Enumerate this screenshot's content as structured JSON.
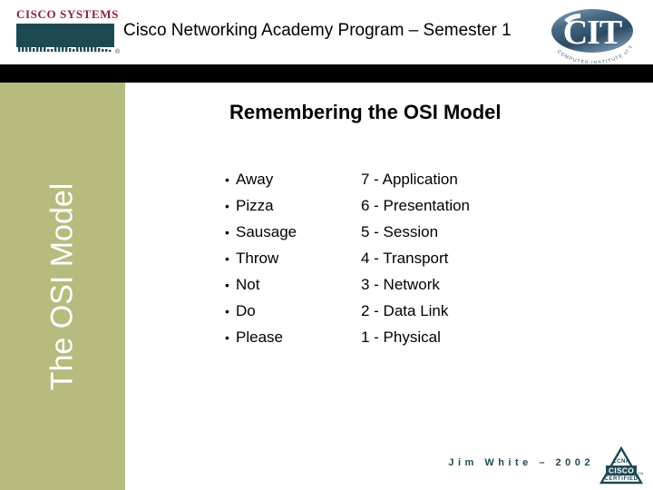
{
  "header": {
    "title": "Cisco Networking Academy Program – Semester 1",
    "cisco_logo": {
      "wordmark": "CISCO SYSTEMS",
      "registered_mark": "®"
    },
    "cit_logo": {
      "letters": "CIT",
      "arc_text": "COMPUTER INSTITUTE of TECHNOLOGY"
    }
  },
  "sidebar": {
    "label": "The OSI Model",
    "color": "#b7bc7e"
  },
  "main": {
    "heading": "Remembering the OSI Model",
    "mnemonic": [
      {
        "bullet": "•",
        "word": "Away"
      },
      {
        "bullet": "•",
        "word": "Pizza"
      },
      {
        "bullet": "•",
        "word": "Sausage"
      },
      {
        "bullet": "•",
        "word": "Throw"
      },
      {
        "bullet": "•",
        "word": "Not"
      },
      {
        "bullet": "•",
        "word": "Do"
      },
      {
        "bullet": "•",
        "word": "Please"
      }
    ],
    "layers": [
      "7 - Application",
      "6 - Presentation",
      "5 - Session",
      "4 - Transport",
      "3 - Network",
      "2 - Data Link",
      "1 - Physical"
    ]
  },
  "footer": {
    "credit": "Jim White – 2002",
    "ccna_logo": {
      "top": "CCNA",
      "middle": "CISCO",
      "bottom": "CERTIFIED",
      "tm": "TM"
    }
  },
  "colors": {
    "olive": "#b7bc7e",
    "cisco_red": "#8d2239",
    "cisco_teal": "#1d4a52",
    "black_bar": "#000000"
  }
}
